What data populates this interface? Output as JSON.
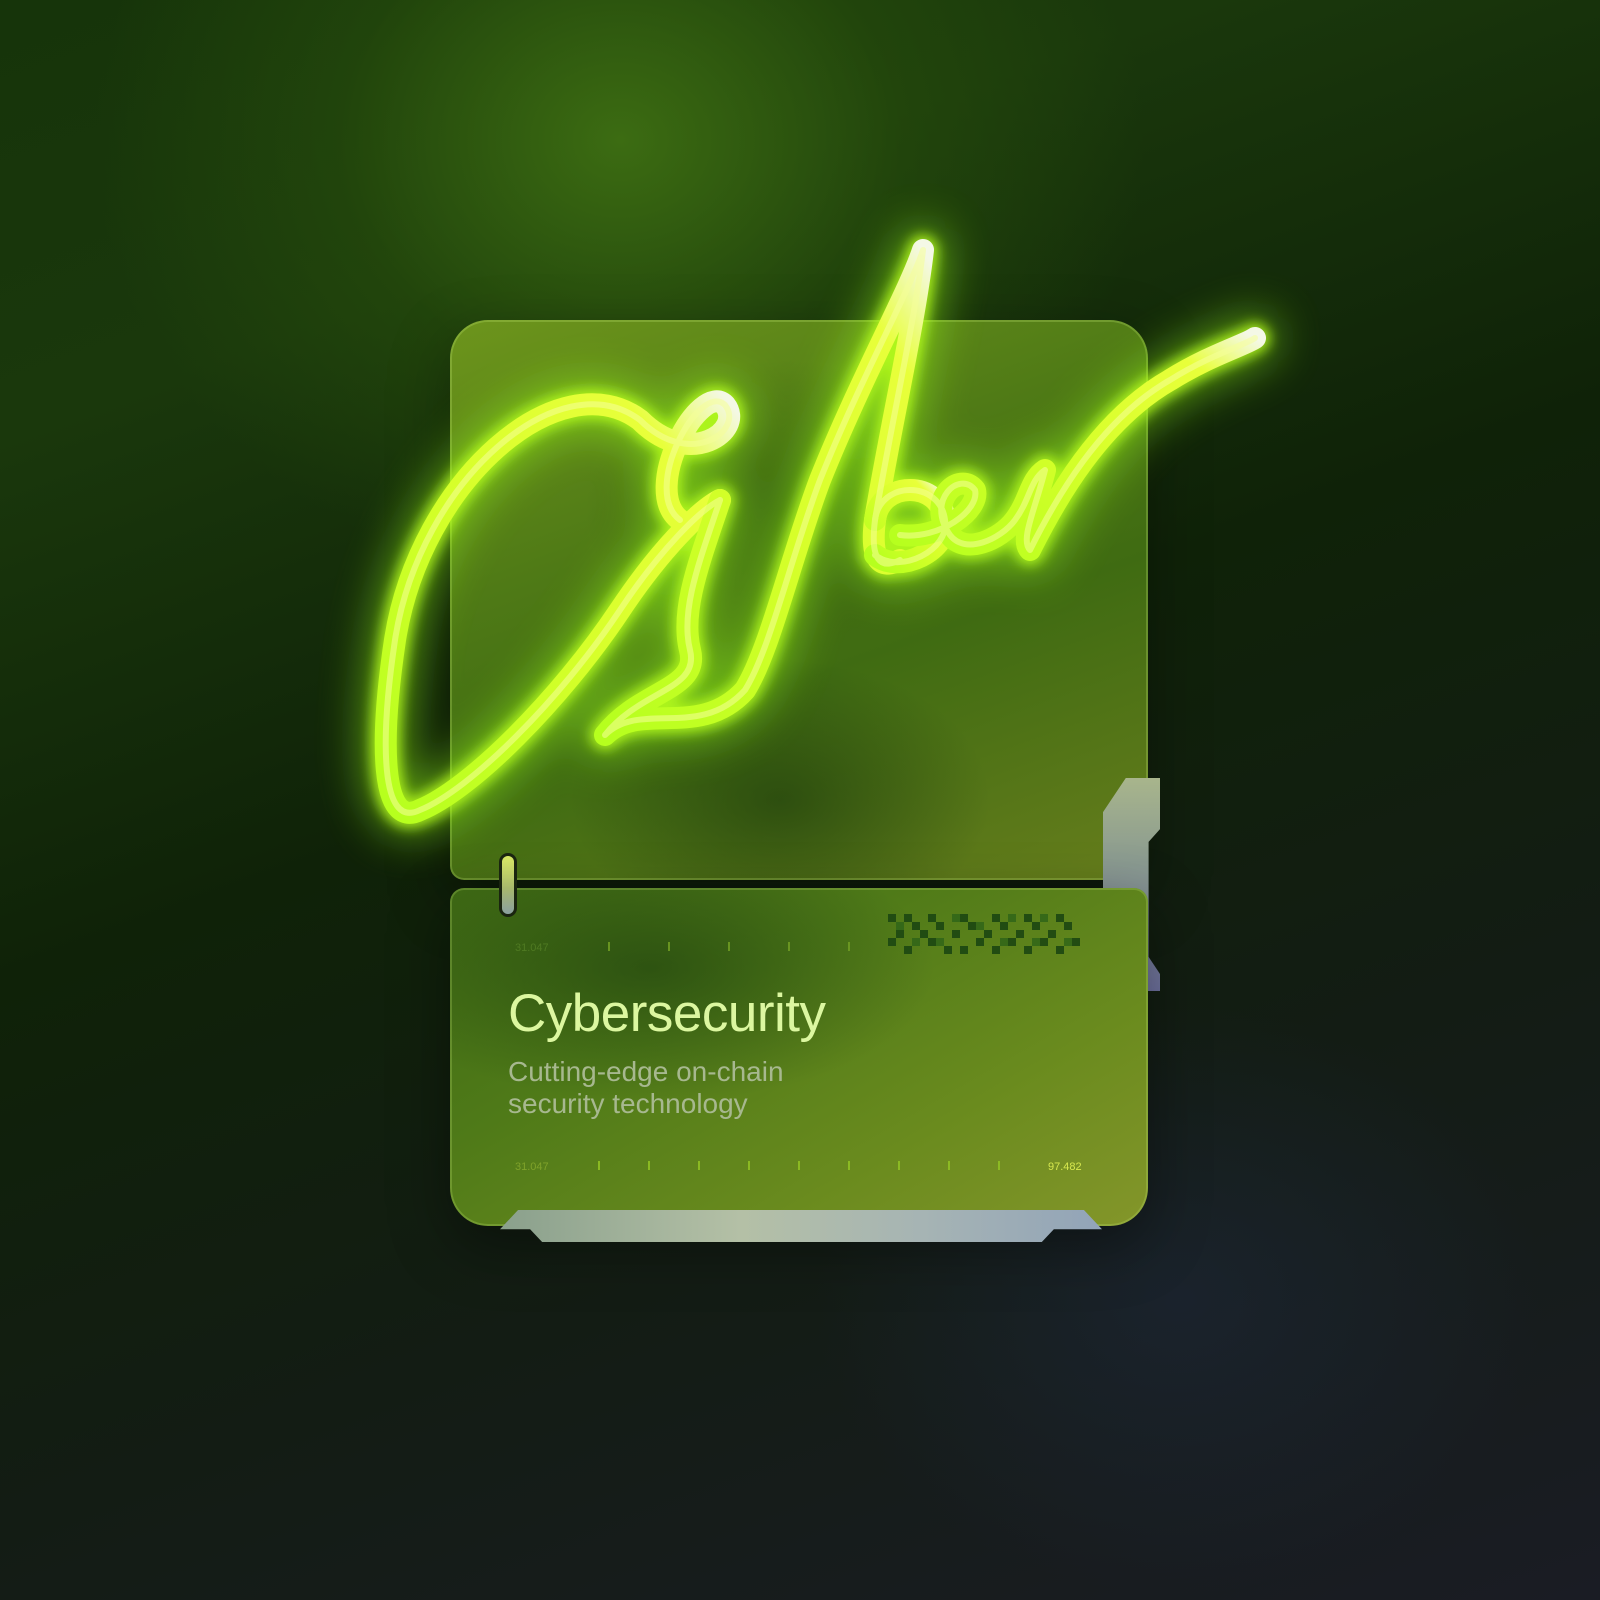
{
  "card": {
    "title": "Cybersecurity",
    "subtitle_line1": "Cutting-edge on-chain",
    "subtitle_line2": "security technology",
    "top_scale_label": "31.047",
    "bottom_scale_start": "31.047",
    "bottom_scale_end": "97.482"
  },
  "neon_script": {
    "text": "Cyber",
    "color": "#c6ff1a",
    "glow": "#9aff1a"
  },
  "colors": {
    "accent": "#d7e84f",
    "title": "#dcf7a0",
    "subtitle": "#a7b88f",
    "panel": "#5b8618"
  }
}
